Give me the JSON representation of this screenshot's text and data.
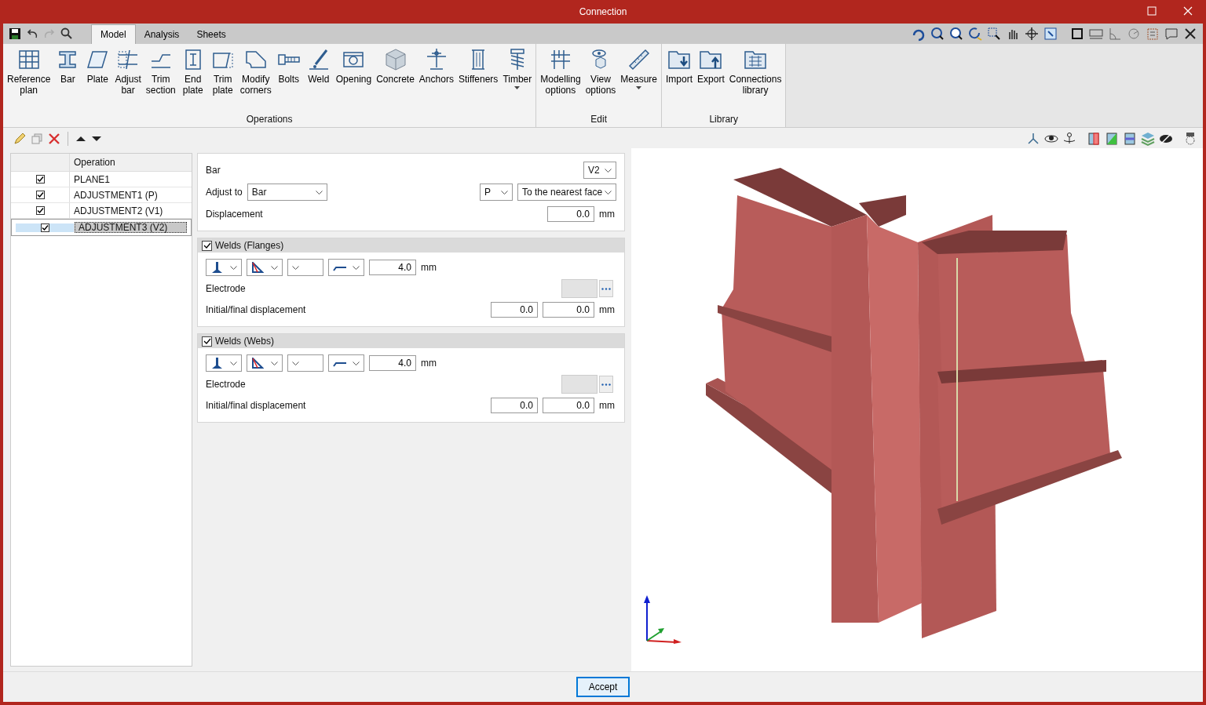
{
  "window": {
    "title": "Connection"
  },
  "tabs": [
    {
      "label": "Model",
      "selected": true
    },
    {
      "label": "Analysis",
      "selected": false
    },
    {
      "label": "Sheets",
      "selected": false
    }
  ],
  "ribbon": [
    {
      "label": "Operations",
      "tools": [
        {
          "label": "Reference\nplan",
          "has_menu": false
        },
        {
          "label": "Bar",
          "has_menu": false
        },
        {
          "label": "Plate",
          "has_menu": false
        },
        {
          "label": "Adjust\nbar",
          "has_menu": false
        },
        {
          "label": "Trim\nsection",
          "has_menu": false
        },
        {
          "label": "End\nplate",
          "has_menu": false
        },
        {
          "label": "Trim\nplate",
          "has_menu": false
        },
        {
          "label": "Modify\ncorners",
          "has_menu": false
        },
        {
          "label": "Bolts",
          "has_menu": false
        },
        {
          "label": "Weld",
          "has_menu": false
        },
        {
          "label": "Opening",
          "has_menu": false
        },
        {
          "label": "Concrete",
          "has_menu": false
        },
        {
          "label": "Anchors",
          "has_menu": false
        },
        {
          "label": "Stiffeners",
          "has_menu": false
        },
        {
          "label": "Timber",
          "has_menu": true
        }
      ]
    },
    {
      "label": "Edit",
      "tools": [
        {
          "label": "Modelling\noptions",
          "has_menu": false
        },
        {
          "label": "View\noptions",
          "has_menu": false
        },
        {
          "label": "Measure",
          "has_menu": true
        }
      ]
    },
    {
      "label": "Library",
      "tools": [
        {
          "label": "Import",
          "has_menu": false
        },
        {
          "label": "Export",
          "has_menu": false
        },
        {
          "label": "Connections\nlibrary",
          "has_menu": false
        }
      ]
    }
  ],
  "operations": {
    "column": "Operation",
    "rows": [
      {
        "name": "PLANE1",
        "checked": true,
        "selected": false
      },
      {
        "name": "ADJUSTMENT1 (P)",
        "checked": true,
        "selected": false
      },
      {
        "name": "ADJUSTMENT2 (V1)",
        "checked": true,
        "selected": false
      },
      {
        "name": "ADJUSTMENT3 (V2)",
        "checked": true,
        "selected": true
      }
    ]
  },
  "form": {
    "bar_label": "Bar",
    "bar_value": "V2",
    "adjust_label": "Adjust to",
    "adjust_value": "Bar",
    "axis_value": "P",
    "face_value": "To the nearest face",
    "displacement_label": "Displacement",
    "displacement_value": "0.0",
    "displacement_unit": "mm"
  },
  "weld_sections": [
    {
      "title": "Welds (Flanges)",
      "checked": true,
      "size": "4.0",
      "size_unit": "mm",
      "electrode_label": "Electrode",
      "displacement_label": "Initial/final displacement",
      "initial": "0.0",
      "final": "0.0",
      "unit": "mm"
    },
    {
      "title": "Welds (Webs)",
      "checked": true,
      "size": "4.0",
      "size_unit": "mm",
      "electrode_label": "Electrode",
      "displacement_label": "Initial/final displacement",
      "initial": "0.0",
      "final": "0.0",
      "unit": "mm"
    }
  ],
  "accept_button": "Accept"
}
